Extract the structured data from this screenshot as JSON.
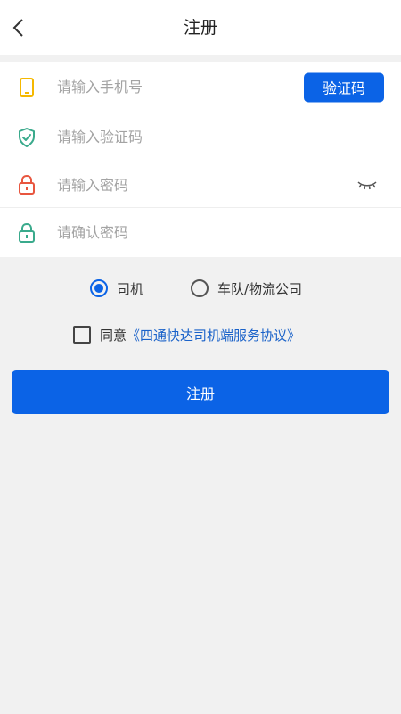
{
  "header": {
    "title": "注册",
    "back_icon": "chevron-left-icon"
  },
  "form": {
    "phone": {
      "placeholder": "请输入手机号",
      "value": "",
      "icon": "phone-icon",
      "icon_color": "#f5b800"
    },
    "code_button": "验证码",
    "code": {
      "placeholder": "请输入验证码",
      "value": "",
      "icon": "shield-check-icon",
      "icon_color": "#3aaa8c"
    },
    "password": {
      "placeholder": "请输入密码",
      "value": "",
      "icon": "lock-icon",
      "icon_color": "#e8563f"
    },
    "confirm": {
      "placeholder": "请确认密码",
      "value": "",
      "icon": "lock-icon",
      "icon_color": "#3aaa8c"
    },
    "eye_icon": "eye-closed-icon"
  },
  "roles": {
    "options": [
      "司机",
      "车队/物流公司"
    ],
    "selected": "司机"
  },
  "agreement": {
    "prefix": "同意",
    "link": "《四通快达司机端服务协议》",
    "checked": false
  },
  "submit_label": "注册",
  "colors": {
    "accent": "#0b63e6",
    "link": "#1a62c9",
    "background": "#f1f1f1"
  }
}
